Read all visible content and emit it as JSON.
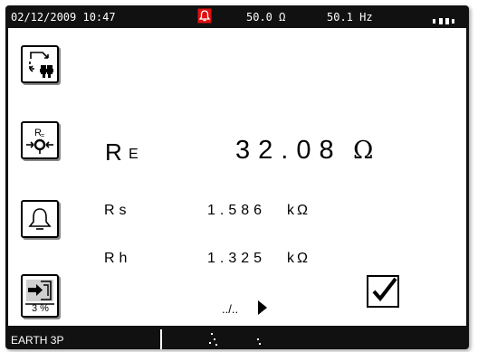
{
  "status_bar": {
    "date_time": "02/12/2009 10:47",
    "voltage": "50.0 Ω",
    "frequency": "50.1 Hz",
    "colors": {
      "alarm": "#e01010",
      "bar_bg": "#111111",
      "text": "#ffffff"
    }
  },
  "side_buttons": {
    "mode_badge": "3 %",
    "icons": [
      "earth-stake-icon",
      "measure-re-icon",
      "alarm-bell-icon",
      "export-percent-icon"
    ]
  },
  "measurement": {
    "main_label": "R",
    "main_label_sub": "E",
    "main_value": "32.08",
    "main_unit": "Ω",
    "rows": [
      {
        "label": "Rs",
        "value": "1.586",
        "unit": "kΩ"
      },
      {
        "label": "Rh",
        "value": "1.325",
        "unit": "kΩ"
      }
    ],
    "more_text": "../..",
    "result_check": "☑"
  },
  "bottom_bar": {
    "mode": "EARTH 3P"
  }
}
